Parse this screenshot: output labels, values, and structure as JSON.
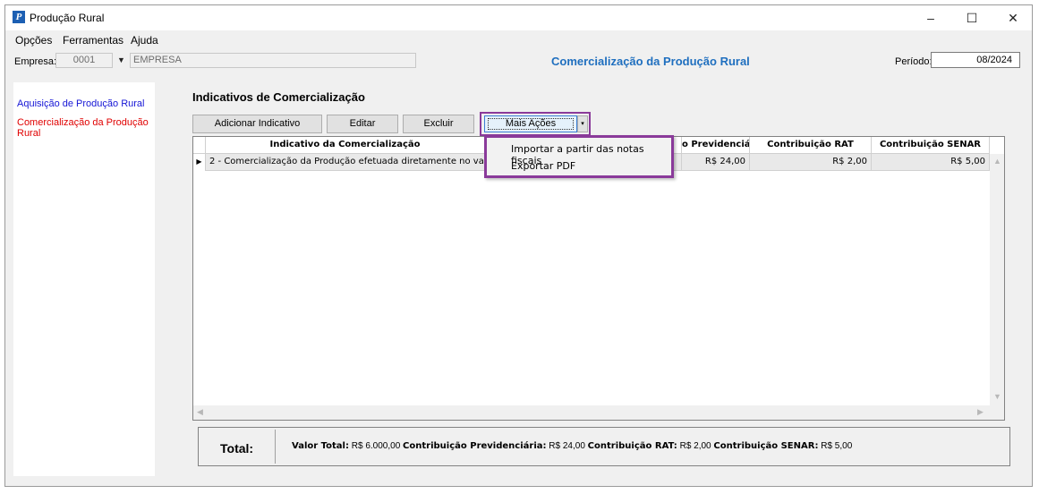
{
  "window": {
    "title": "Produção Rural",
    "icon_letter": "P",
    "controls": {
      "minimize": "–",
      "maximize": "☐",
      "close": "✕"
    }
  },
  "menu": [
    "Opções",
    "Ferramentas",
    "Ajuda"
  ],
  "header": {
    "empresa_label": "Empresa:",
    "empresa_code": "0001",
    "empresa_name": "EMPRESA",
    "page_title": "Comercialização da Produção Rural",
    "periodo_label": "Período:",
    "periodo_value": "08/2024"
  },
  "sidebar": {
    "items": [
      {
        "label": "Aquisição de Produção Rural",
        "color": "#1515d6"
      },
      {
        "label": "Comercialização da Produção Rural",
        "color": "#e00000"
      }
    ]
  },
  "section_title": "Indicativos de Comercialização",
  "toolbar": {
    "add_label": "Adicionar Indicativo",
    "edit_label": "Editar",
    "delete_label": "Excluir",
    "more_label": "Mais Ações",
    "more_arrow": "▾"
  },
  "more_menu": {
    "items": [
      "Importar a partir das notas fiscais",
      "Exportar PDF"
    ]
  },
  "grid": {
    "columns": [
      "Indicativo da Comercialização",
      "",
      "o Previdenciária",
      "Contribuição RAT",
      "Contribuição SENAR"
    ],
    "rows": [
      {
        "marker": "▶",
        "indicativo": "2 - Comercialização da Produção efetuada diretamente no varejo a...",
        "previdenciaria": "R$ 24,00",
        "rat": "R$ 2,00",
        "senar": "R$ 5,00"
      }
    ]
  },
  "totals": {
    "label": "Total:",
    "valor_total_label": "Valor Total:",
    "valor_total": "R$ 6.000,00",
    "previdenciaria_label": "Contribuição Previdenciária:",
    "previdenciaria": "R$ 24,00",
    "rat_label": "Contribuição RAT:",
    "rat": "R$ 2,00",
    "senar_label": "Contribuição SENAR:",
    "senar": "R$ 5,00"
  },
  "accent_color": "#8a3a9a",
  "title_color": "#1f6fbf"
}
